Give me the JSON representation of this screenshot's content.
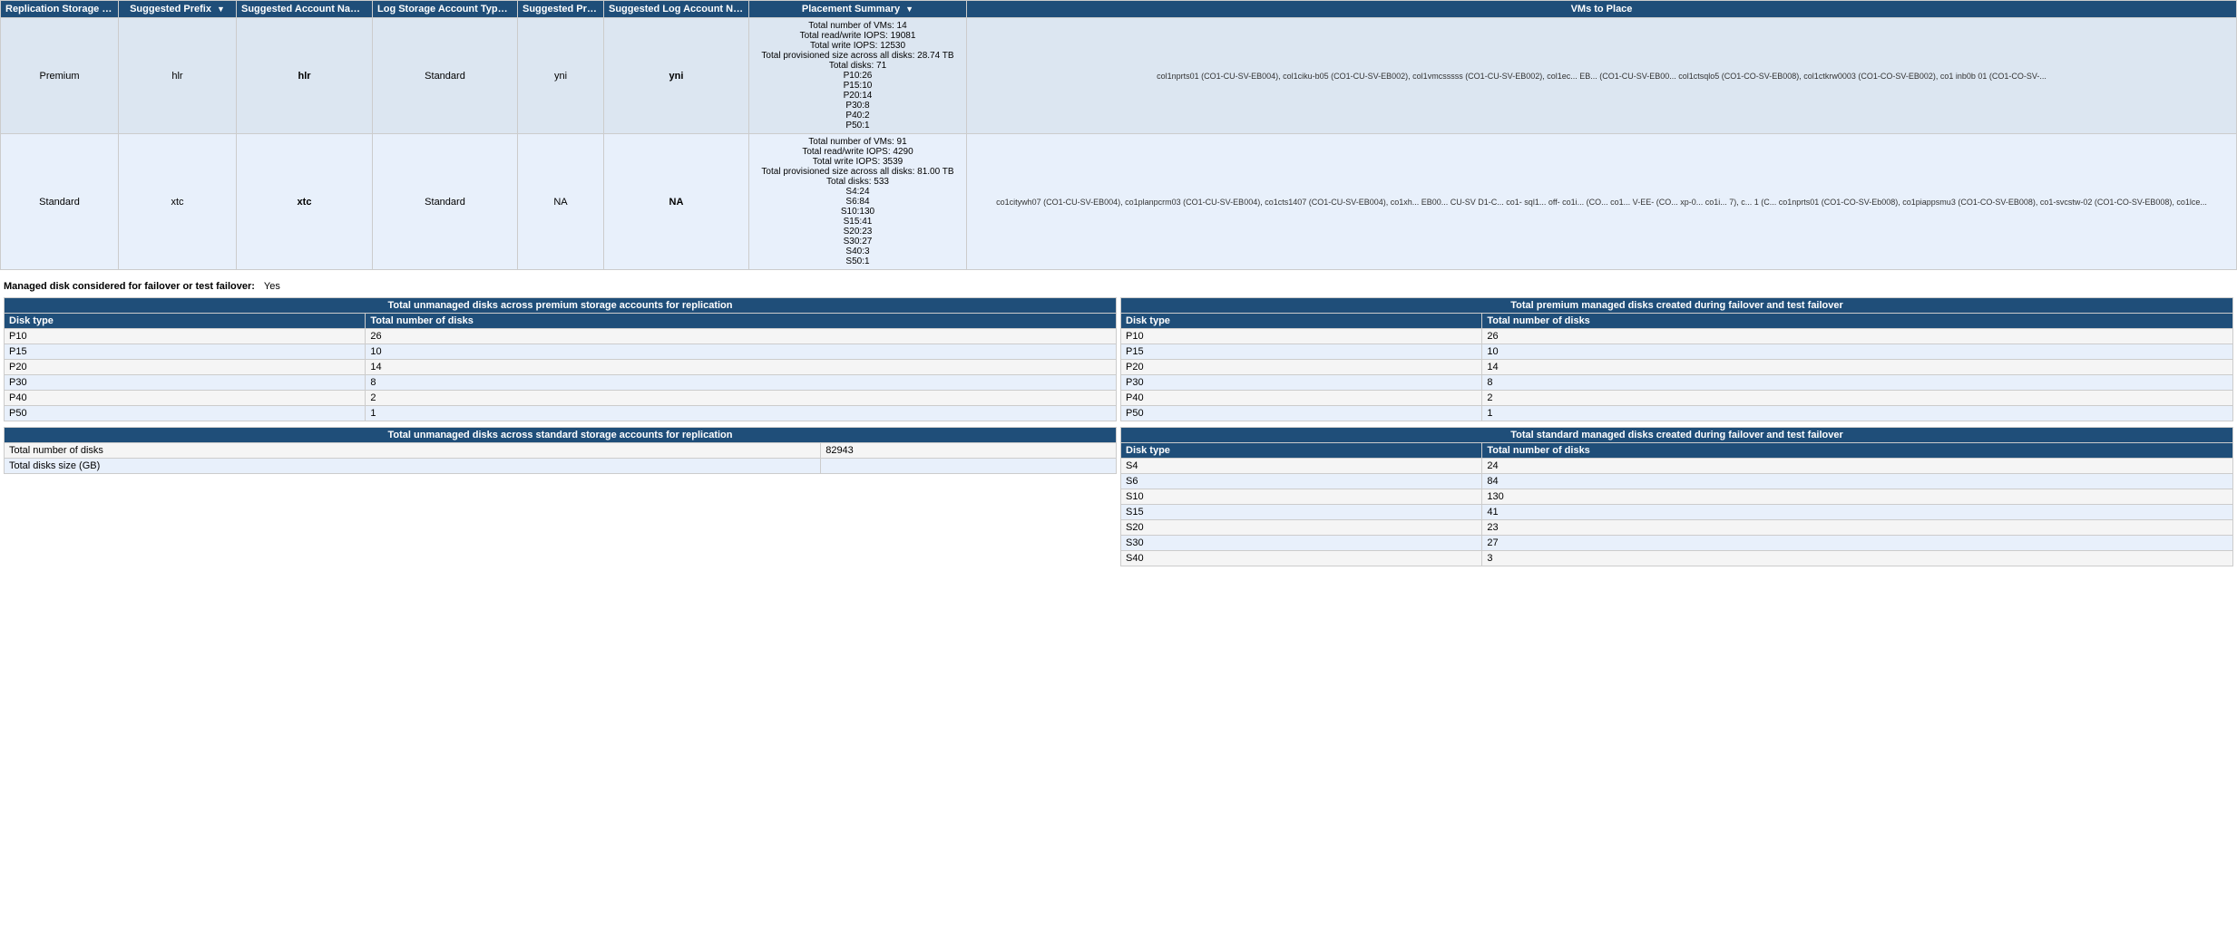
{
  "header": {
    "col1": "Replication Storage Type",
    "col2": "Suggested Prefix",
    "col3": "Suggested Account Name",
    "col4": "Log Storage Account Type",
    "col5": "Suggested Prefix",
    "col6": "Suggested Log Account Name",
    "col7": "Placement Summary",
    "col8": "VMs to Place"
  },
  "rows": [
    {
      "type": "Premium",
      "prefix": "hlr",
      "accountName": "hlr<premium1>",
      "logType": "Standard",
      "logPrefix": "yni",
      "logAccountName": "yni<standard2>",
      "placement": {
        "totalVMs": 14,
        "readWriteIOPS": 19081,
        "writeIOPS": 12530,
        "provisionedSize": "28.74 TB",
        "totalDisks": 71,
        "diskBreakdown": [
          "P10:26",
          "P15:10",
          "P20:14",
          "P30:8",
          "P40:2",
          "P50:1"
        ]
      },
      "vmsText": "col1nprts01 (CO1-CU-SV-EB004), col1ciku-b05 (CO1-CU-SV-EB002), col1vmcsssss (CO1-CU-SV-EB002), col1ec... EB... (CO1-CU-SV-EB00...  col1ctsqlo5 (CO1-CO-SV-EB008), col1ctkrw0003 (CO1-CO-SV-EB002), co1 inb0b 01 (CO1-CO-SV-..."
    },
    {
      "type": "Standard",
      "prefix": "xtc",
      "accountName": "xtc<standard1>",
      "logType": "Standard",
      "logPrefix": "NA",
      "logAccountName": "NA",
      "placement": {
        "totalVMs": 91,
        "readWriteIOPS": 4290,
        "writeIOPS": 3539,
        "provisionedSize": "81.00 TB",
        "totalDisks": 533,
        "diskBreakdown": [
          "S4:24",
          "S6:84",
          "S10:130",
          "S15:41",
          "S20:23",
          "S30:27",
          "S40:3",
          "S50:1"
        ]
      },
      "vmsText": "co1citywh07 (CO1-CU-SV-EB004), co1planpcrm03 (CO1-CU-SV-EB004), co1cts1407 (CO1-CU-SV-EB004), co1xh... EB00... CU-SV D1-C... co1- sql1... off- co1i... (CO... co1... V-EE- (CO... xp-0... co1i... 7), c... 1 (C... co1nprts01 (CO1-CO-SV-Eb008), co1piappsmu3 (CO1-CO-SV-EB008), co1-svcstw-02 (CO1-CO-SV-EB008), co1lce..."
    }
  ],
  "managedDisk": {
    "label": "Managed disk considered for failover or test failover:",
    "value": "Yes"
  },
  "premiumUnmanaged": {
    "title": "Total  unmanaged disks across premium storage accounts for replication",
    "col1": "Disk type",
    "col2": "Total number of disks",
    "rows": [
      {
        "type": "P10",
        "count": 26
      },
      {
        "type": "P15",
        "count": 10
      },
      {
        "type": "P20",
        "count": 14
      },
      {
        "type": "P30",
        "count": 8
      },
      {
        "type": "P40",
        "count": 2
      },
      {
        "type": "P50",
        "count": 1
      }
    ]
  },
  "premiumManaged": {
    "title": "Total premium managed disks created during failover and test failover",
    "col1": "Disk type",
    "col2": "Total number of disks",
    "rows": [
      {
        "type": "P10",
        "count": 26
      },
      {
        "type": "P15",
        "count": 10
      },
      {
        "type": "P20",
        "count": 14
      },
      {
        "type": "P30",
        "count": 8
      },
      {
        "type": "P40",
        "count": 2
      },
      {
        "type": "P50",
        "count": 1
      }
    ]
  },
  "standardUnmanaged": {
    "title": "Total unmanaged disks across standard storage accounts for replication",
    "rows": [
      {
        "label": "Total number of disks",
        "value": "82943"
      },
      {
        "label": "Total disks size (GB)",
        "value": ""
      }
    ]
  },
  "standardManaged": {
    "title": "Total standard managed disks created during failover and test failover",
    "col1": "Disk type",
    "col2": "Total number of disks",
    "rows": [
      {
        "type": "S4",
        "count": 24
      },
      {
        "type": "S6",
        "count": 84
      },
      {
        "type": "S10",
        "count": 130
      },
      {
        "type": "S15",
        "count": 41
      },
      {
        "type": "S20",
        "count": 23
      },
      {
        "type": "S30",
        "count": 27
      },
      {
        "type": "S40",
        "count": 3
      }
    ]
  }
}
